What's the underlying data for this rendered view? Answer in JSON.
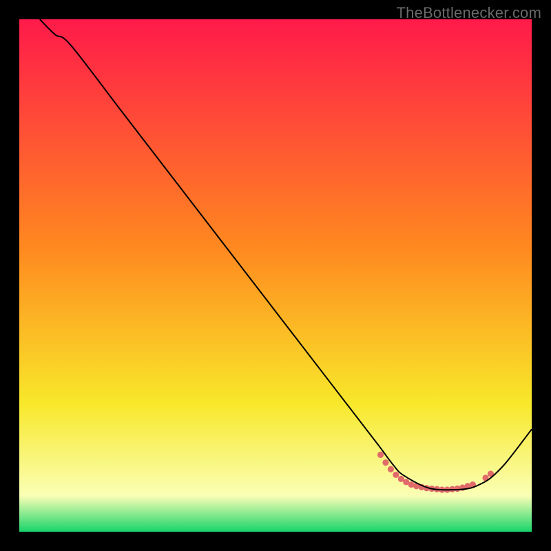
{
  "attribution": "TheBottlenecker.com",
  "chart_data": {
    "type": "line",
    "title": "",
    "xlabel": "",
    "ylabel": "",
    "xlim": [
      0,
      100
    ],
    "ylim": [
      0,
      100
    ],
    "grid": false,
    "legend": false,
    "background_gradient": {
      "top": "#ff1a4a",
      "mid1": "#ff8a1f",
      "mid2": "#f8e82a",
      "low": "#faffb5",
      "bottom": "#18d46a"
    },
    "series": [
      {
        "name": "curve",
        "x": [
          4,
          7,
          10,
          20,
          30,
          40,
          50,
          60,
          65,
          70,
          73,
          75,
          80,
          85,
          88,
          90,
          92,
          95,
          100
        ],
        "y": [
          100,
          97,
          95,
          82,
          69,
          56,
          43,
          30,
          23.5,
          17,
          13,
          11,
          8.5,
          8.2,
          8.5,
          9.3,
          10.5,
          13.5,
          20
        ],
        "color": "#000000",
        "width": 2
      }
    ],
    "markers": {
      "name": "trough-dots",
      "color": "#e16a6a",
      "radius": 4.6,
      "points": [
        {
          "x": 70.5,
          "y": 15.0
        },
        {
          "x": 71.5,
          "y": 13.5
        },
        {
          "x": 72.5,
          "y": 12.2
        },
        {
          "x": 73.5,
          "y": 11.1
        },
        {
          "x": 74.5,
          "y": 10.3
        },
        {
          "x": 75.5,
          "y": 9.7
        },
        {
          "x": 76.5,
          "y": 9.2
        },
        {
          "x": 77.5,
          "y": 8.9
        },
        {
          "x": 78.5,
          "y": 8.7
        },
        {
          "x": 79.5,
          "y": 8.5
        },
        {
          "x": 80.5,
          "y": 8.4
        },
        {
          "x": 81.5,
          "y": 8.3
        },
        {
          "x": 82.5,
          "y": 8.2
        },
        {
          "x": 83.5,
          "y": 8.2
        },
        {
          "x": 84.5,
          "y": 8.3
        },
        {
          "x": 85.5,
          "y": 8.4
        },
        {
          "x": 86.5,
          "y": 8.6
        },
        {
          "x": 87.5,
          "y": 8.9
        },
        {
          "x": 88.5,
          "y": 9.2
        },
        {
          "x": 91.0,
          "y": 10.5
        },
        {
          "x": 92.0,
          "y": 11.3
        }
      ]
    }
  }
}
